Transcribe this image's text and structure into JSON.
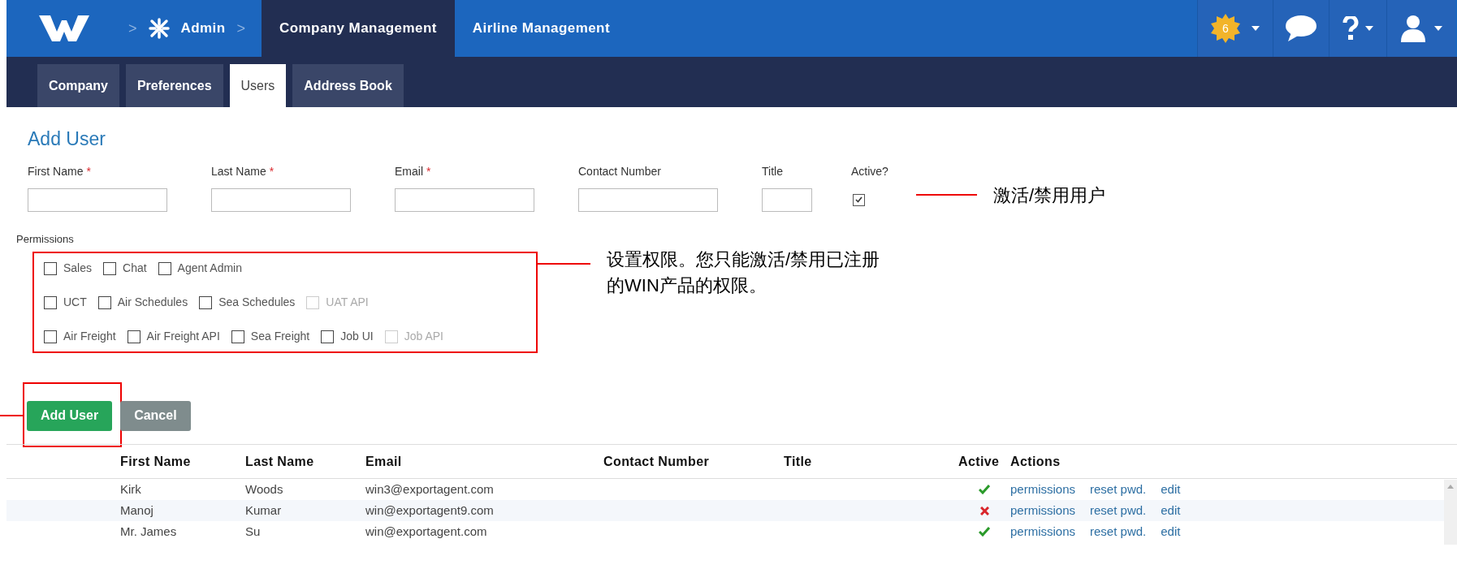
{
  "top_nav": {
    "breadcrumb": [
      {
        "kind": "separator",
        "text": ">"
      },
      {
        "kind": "link",
        "text": "Admin"
      },
      {
        "kind": "separator",
        "text": ">"
      }
    ],
    "tabs": [
      {
        "label": "Company Management",
        "selected": true
      },
      {
        "label": "Airline Management",
        "selected": false
      }
    ],
    "notification_count": "6"
  },
  "sub_tabs": [
    {
      "label": "Company",
      "selected": false
    },
    {
      "label": "Preferences",
      "selected": false
    },
    {
      "label": "Users",
      "selected": true
    },
    {
      "label": "Address Book",
      "selected": false
    }
  ],
  "form": {
    "heading": "Add User",
    "fields": [
      {
        "label": "First Name",
        "required_mark": "*",
        "kind": "text"
      },
      {
        "label": "Last Name",
        "required_mark": "*",
        "kind": "text"
      },
      {
        "label": "Email",
        "required_mark": "*",
        "kind": "text"
      },
      {
        "label": "Contact Number",
        "kind": "text"
      },
      {
        "label": "Title",
        "kind": "short"
      },
      {
        "label": "Active?",
        "kind": "checkbox",
        "checked": true
      }
    ],
    "permissions_label": "Permissions",
    "permissions": [
      [
        {
          "label": "Sales",
          "checked": false,
          "disabled": false
        },
        {
          "label": "Chat",
          "checked": false,
          "disabled": false
        },
        {
          "label": "Agent Admin",
          "checked": false,
          "disabled": false
        }
      ],
      [
        {
          "label": "UCT",
          "checked": false,
          "disabled": false
        },
        {
          "label": "Air Schedules",
          "checked": false,
          "disabled": false
        },
        {
          "label": "Sea Schedules",
          "checked": false,
          "disabled": false
        },
        {
          "label": "UAT API",
          "checked": false,
          "disabled": true
        }
      ],
      [
        {
          "label": "Air Freight",
          "checked": false,
          "disabled": false
        },
        {
          "label": "Air Freight API",
          "checked": false,
          "disabled": false
        },
        {
          "label": "Sea Freight",
          "checked": false,
          "disabled": false
        },
        {
          "label": "Job UI",
          "checked": false,
          "disabled": false
        },
        {
          "label": "Job API",
          "checked": false,
          "disabled": true
        }
      ]
    ],
    "buttons": [
      {
        "label": "Add User",
        "kind": "primary"
      },
      {
        "label": "Cancel",
        "kind": "secondary"
      }
    ]
  },
  "annotations": [
    "激活/禁用用户",
    "设置权限。您只能激活/禁用已注册的WIN产品的权限。"
  ],
  "table": {
    "columns": [
      "First Name",
      "Last Name",
      "Email",
      "Contact Number",
      "Title",
      "Active",
      "Actions"
    ],
    "rows": [
      {
        "first_name": "Kirk",
        "last_name": "Woods",
        "email": "win3@exportagent.com",
        "active": true,
        "actions": [
          "permissions",
          "reset pwd.",
          "edit"
        ]
      },
      {
        "first_name": "Manoj",
        "last_name": "Kumar",
        "email": "win@exportagent9.com",
        "active": false,
        "actions": [
          "permissions",
          "reset pwd.",
          "edit"
        ]
      },
      {
        "first_name": "Mr. James",
        "last_name": "Su",
        "email": "win@exportagent.com",
        "active": true,
        "actions": [
          "permissions",
          "reset pwd.",
          "edit"
        ]
      }
    ]
  }
}
